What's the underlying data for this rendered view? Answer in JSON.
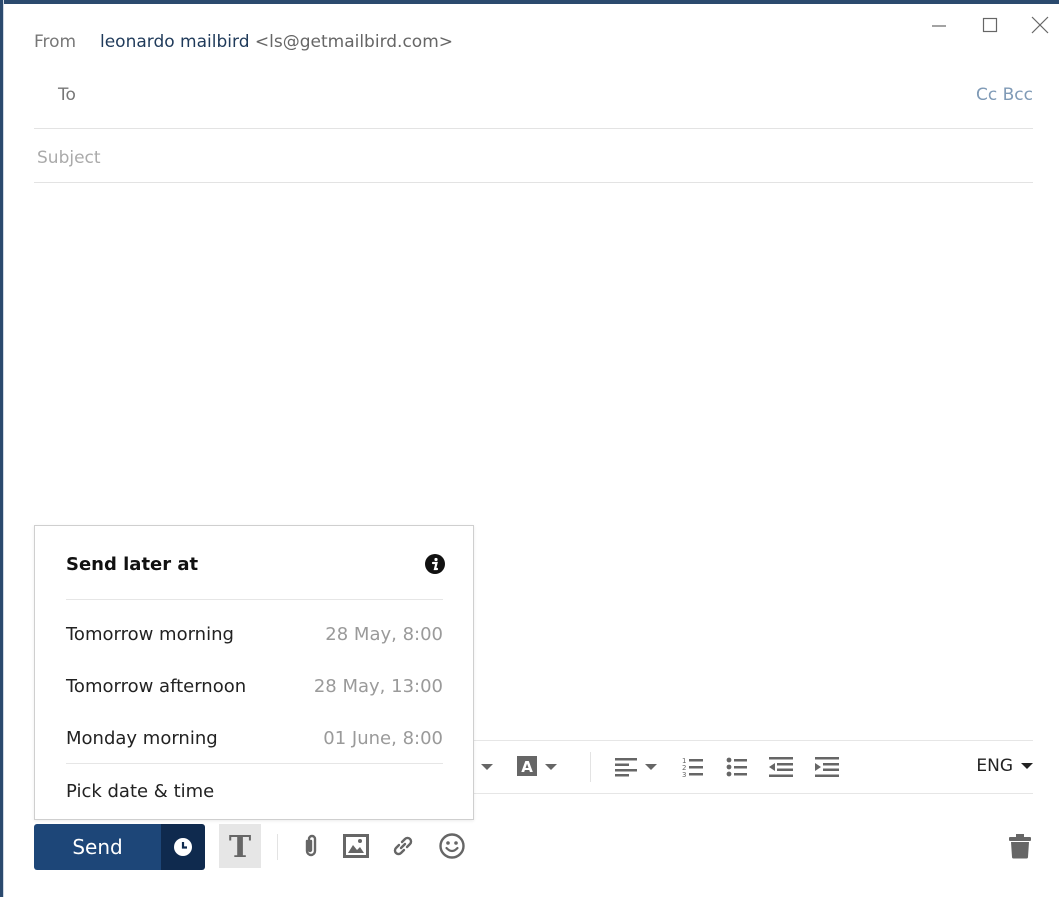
{
  "window": {
    "controls": {
      "minimize": "minimize-icon",
      "maximize": "maximize-icon",
      "close": "close-icon"
    }
  },
  "header": {
    "from_label": "From",
    "from_name": "leonardo mailbird",
    "from_address": "<ls@getmailbird.com>",
    "to_label": "To",
    "to_value": "",
    "cc_bcc_label": "Cc Bcc",
    "subject_placeholder": "Subject",
    "subject_value": ""
  },
  "toolbar": {
    "language": "ENG",
    "icons": [
      "dropdown-arrow-icon",
      "text-highlight-color-icon",
      "align-left-icon",
      "numbered-list-icon",
      "bulleted-list-icon",
      "outdent-icon",
      "indent-icon"
    ]
  },
  "send_later_popup": {
    "title": "Send later at",
    "info_icon": "info-icon",
    "options": [
      {
        "label": "Tomorrow morning",
        "when": "28 May, 8:00"
      },
      {
        "label": "Tomorrow afternoon",
        "when": "28 May, 13:00"
      },
      {
        "label": "Monday morning",
        "when": "01 June, 8:00"
      }
    ],
    "pick_label": "Pick date & time"
  },
  "bottom_bar": {
    "send_label": "Send",
    "icons": [
      "send-later-clock-icon",
      "text-format-icon",
      "attachment-icon",
      "image-icon",
      "link-icon",
      "emoji-icon",
      "trash-icon"
    ]
  },
  "colors": {
    "send_primary": "#1d4678",
    "send_later_bg": "#0f2a4e",
    "from_name": "#1f3a5a",
    "cc_bcc": "#7f9ab6"
  }
}
